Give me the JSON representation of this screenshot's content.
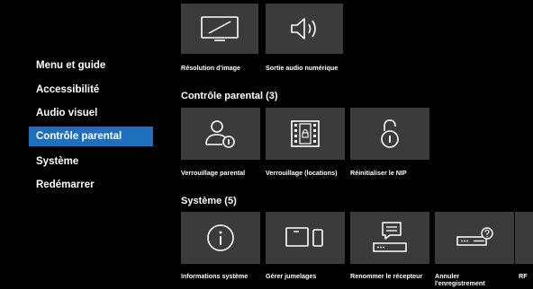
{
  "sidebar": {
    "items": [
      {
        "label": "Menu et guide"
      },
      {
        "label": "Accessibilité"
      },
      {
        "label": "Audio visuel"
      },
      {
        "label": "Contrôle parental"
      },
      {
        "label": "Système"
      },
      {
        "label": "Redémarrer"
      }
    ],
    "active_index": 3
  },
  "audio_visual": {
    "tiles": [
      {
        "label": "Résolution d'image",
        "icon": "monitor-resize-icon"
      },
      {
        "label": "Sortie audio numérique",
        "icon": "speaker-icon"
      }
    ]
  },
  "parental": {
    "title": "Contrôle parental (3)",
    "tiles": [
      {
        "label": "Verrouillage parental",
        "icon": "user-lock-icon"
      },
      {
        "label": "Verrouillage (locations)",
        "icon": "film-lock-icon"
      },
      {
        "label": "Réinitialiser le NIP",
        "icon": "padlock-open-icon"
      }
    ]
  },
  "system": {
    "title": "Système (5)",
    "tiles": [
      {
        "label": "Informations système",
        "icon": "info-icon"
      },
      {
        "label": "Gérer jumelages",
        "icon": "devices-icon"
      },
      {
        "label": "Renommer le récepteur",
        "icon": "receiver-message-icon"
      },
      {
        "label": "Annuler l'enregistrement",
        "icon": "receiver-help-icon"
      },
      {
        "label": "RF",
        "icon": "rf-icon"
      }
    ]
  },
  "colors": {
    "accent": "#1f6fbf",
    "tile": "#3b3b3b",
    "background": "#000000"
  }
}
